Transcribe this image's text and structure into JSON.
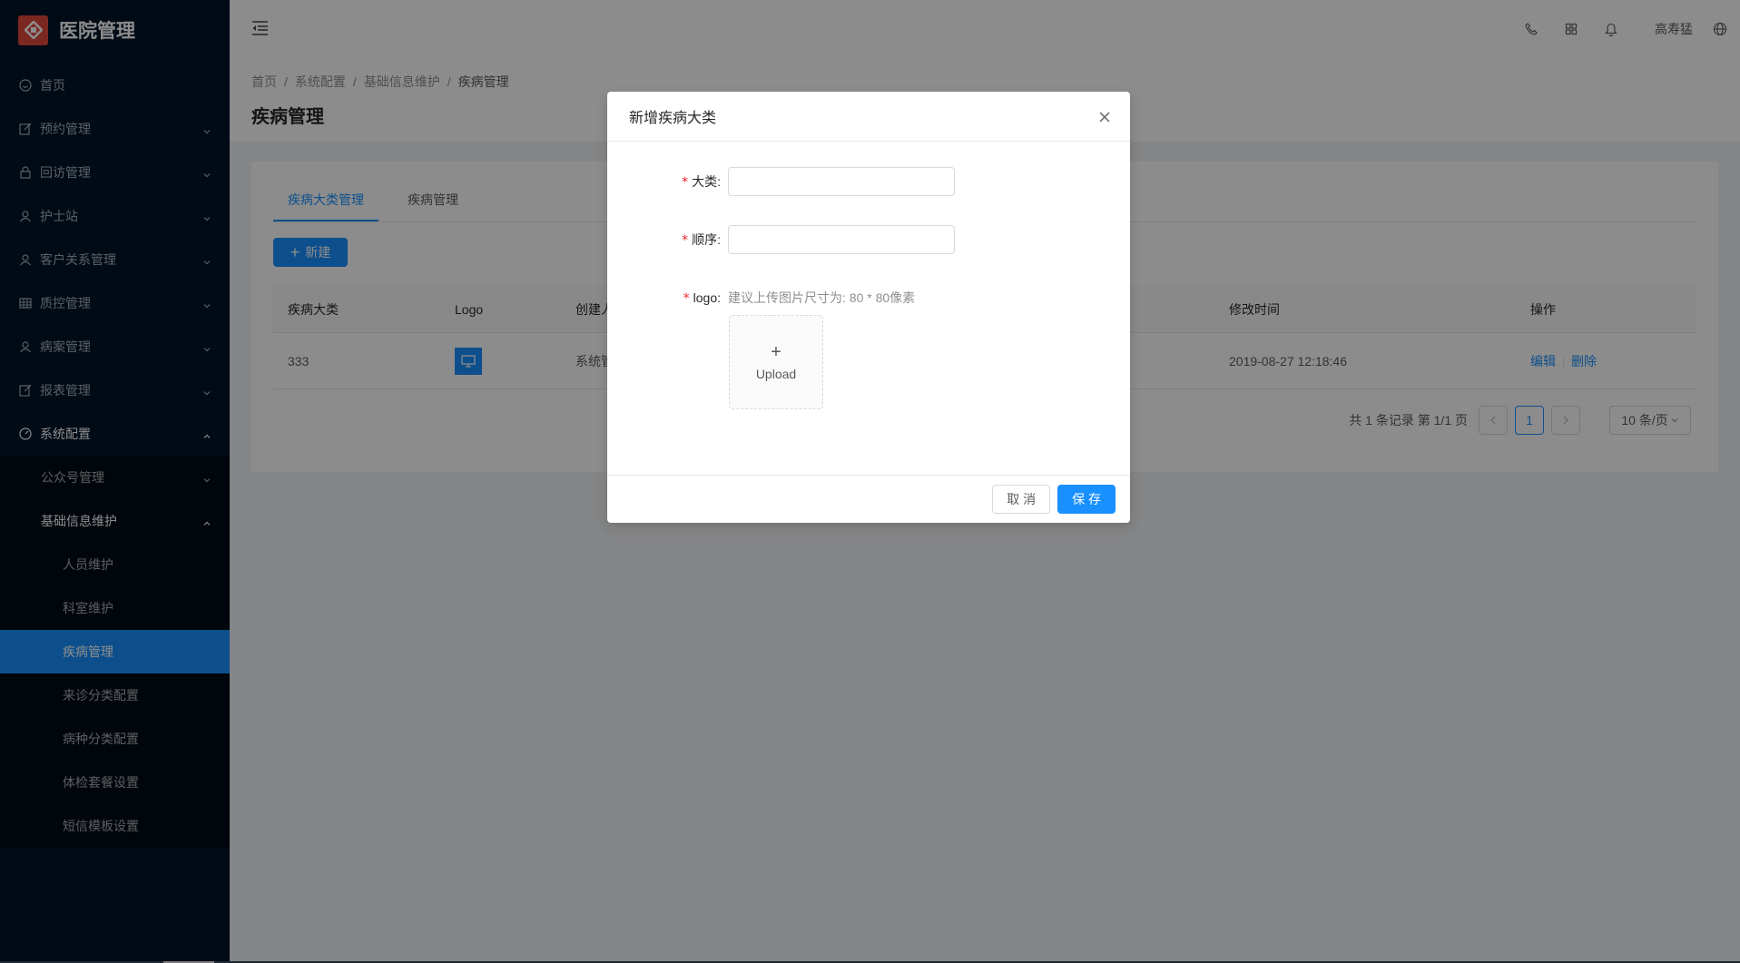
{
  "app": {
    "title": "医院管理",
    "accent": "#1890ff",
    "logo_color": "#e0483e"
  },
  "sidebar": {
    "items": [
      {
        "label": "首页",
        "icon": "smile-icon"
      },
      {
        "label": "预约管理",
        "icon": "form-icon"
      },
      {
        "label": "回访管理",
        "icon": "lock-icon"
      },
      {
        "label": "护士站",
        "icon": "user-icon"
      },
      {
        "label": "客户关系管理",
        "icon": "user-icon"
      },
      {
        "label": "质控管理",
        "icon": "table-icon"
      },
      {
        "label": "病案管理",
        "icon": "user-icon"
      },
      {
        "label": "报表管理",
        "icon": "form-icon"
      },
      {
        "label": "系统配置",
        "icon": "dashboard-icon"
      }
    ],
    "system_children": [
      {
        "label": "公众号管理"
      },
      {
        "label": "基础信息维护"
      }
    ],
    "base_children": [
      {
        "label": "人员维护"
      },
      {
        "label": "科室维护"
      },
      {
        "label": "疾病管理"
      },
      {
        "label": "来诊分类配置"
      },
      {
        "label": "病种分类配置"
      },
      {
        "label": "体检套餐设置"
      },
      {
        "label": "短信模板设置"
      }
    ]
  },
  "header": {
    "username": "高寿猛"
  },
  "breadcrumb": [
    "首页",
    "系统配置",
    "基础信息维护",
    "疾病管理"
  ],
  "page_title": "疾病管理",
  "tabs": [
    "疾病大类管理",
    "疾病管理"
  ],
  "new_button": "新建",
  "table": {
    "columns": [
      "疾病大类",
      "Logo",
      "创建人",
      "修改时间",
      "操作"
    ],
    "rows": [
      {
        "category": "333",
        "creator": "系统管",
        "modified": "2019-08-27 12:18:46",
        "edit": "编辑",
        "delete": "删除"
      }
    ]
  },
  "pagination": {
    "total_text": "共 1 条记录 第 1/1 页",
    "current": "1",
    "page_size": "10 条/页"
  },
  "modal": {
    "title": "新增疾病大类",
    "fields": {
      "category": {
        "label": "大类",
        "value": "",
        "placeholder": ""
      },
      "order": {
        "label": "顺序",
        "value": "",
        "placeholder": ""
      },
      "logo": {
        "label": "logo",
        "hint": "建议上传图片尺寸为: 80 * 80像素",
        "upload_label": "Upload"
      }
    },
    "cancel": "取 消",
    "save": "保 存"
  }
}
